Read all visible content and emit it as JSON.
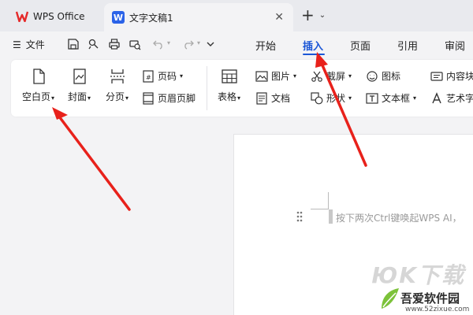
{
  "tabs": {
    "home_label": "WPS Office",
    "doc_label": "文字文稿1",
    "close_glyph": "✕",
    "new_tab_glyph": "+",
    "dropdown_glyph": "⌄"
  },
  "menu": {
    "file_icon_glyph": "☰",
    "file_label": "文件",
    "tabs": [
      "开始",
      "插入",
      "页面",
      "引用",
      "审阅"
    ],
    "active_tab": "插入",
    "accent_color": "#1b56d6"
  },
  "ribbon": {
    "blank_page": "空白页",
    "cover": "封面",
    "section": "分页",
    "page_number": "页码",
    "header_footer": "页眉页脚",
    "table": "表格",
    "picture": "图片",
    "document": "文档",
    "screenshot": "截屏",
    "shape": "形状",
    "icon": "图标",
    "textbox": "文本框",
    "content_block": "内容块",
    "art_text": "艺术字",
    "dropdown_glyph": "▾"
  },
  "document": {
    "placeholder": "按下两次Ctrl键唤起WPS AI，"
  },
  "watermark": {
    "big_text": "ЮK下载",
    "site_name": "吾爱软件园",
    "site_url": "www.52zixue.com"
  },
  "annotation_color": "#e8211b"
}
